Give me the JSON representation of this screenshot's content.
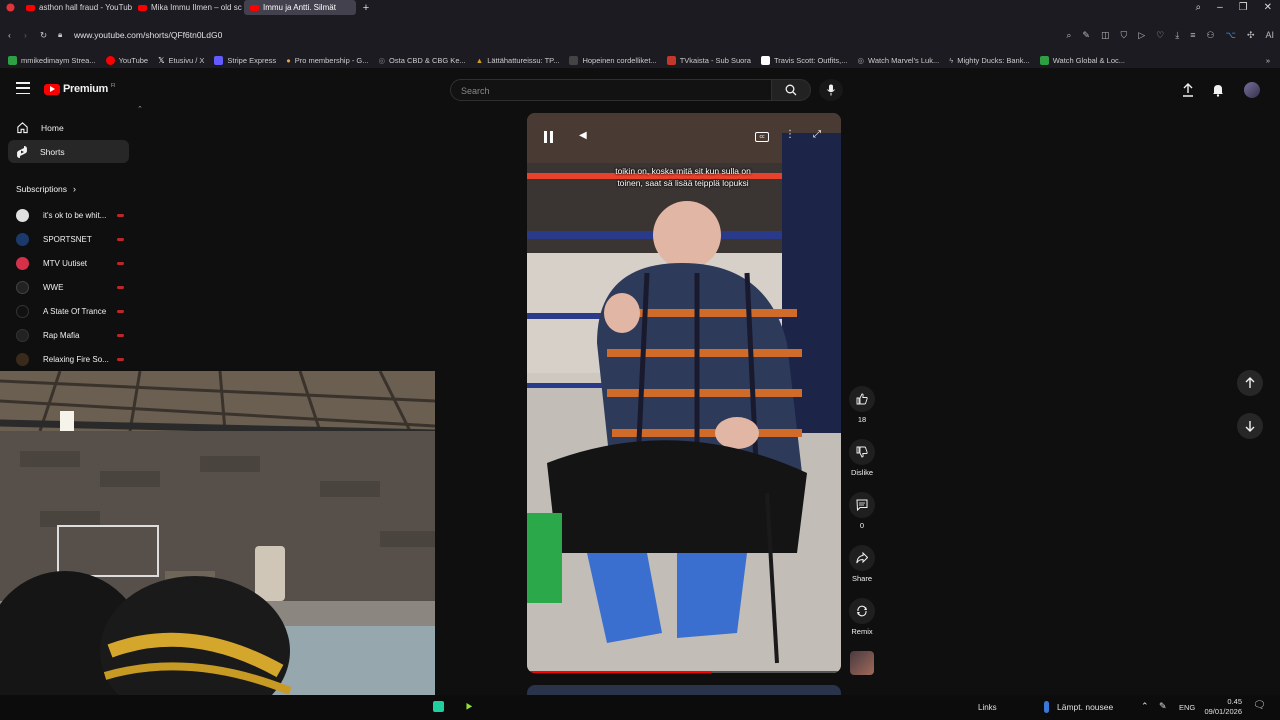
{
  "browser": {
    "tabs": [
      {
        "label": "asthon hall fraud - YouTub",
        "active": false
      },
      {
        "label": "Mika Immu Ilmen – old sc",
        "active": false
      },
      {
        "label": "Immu ja Antti. Silmät",
        "active": true
      }
    ],
    "url": "www.youtube.com/shorts/QFf6tn0LdG0",
    "bookmarks": [
      {
        "label": "mmikedimaym Strea...",
        "color": "#2ea043"
      },
      {
        "label": "YouTube",
        "color": "#ff0000"
      },
      {
        "label": "Etusivu / X",
        "color": "#ffffff"
      },
      {
        "label": "Stripe Express",
        "color": "#635bff"
      },
      {
        "label": "Pro membership - G...",
        "color": "#e8a33d"
      },
      {
        "label": "Osta CBD & CBG Ke...",
        "color": "#888888"
      },
      {
        "label": "Lättähattureissu: TP...",
        "color": "#d4a017"
      },
      {
        "label": "Hopeinen cordelliket...",
        "color": "#444444"
      },
      {
        "label": "TVkaista - Sub Suora",
        "color": "#c0392b"
      },
      {
        "label": "Travis Scott: Outfits,...",
        "color": "#ffffff"
      },
      {
        "label": "Watch Marvel's Luk...",
        "color": "#aaaaaa"
      },
      {
        "label": "Mighty Ducks: Bank...",
        "color": "#aaaaaa"
      },
      {
        "label": "Watch Global & Loc...",
        "color": "#2ea043"
      }
    ]
  },
  "youtube": {
    "logo_text": "Premium",
    "logo_badge": "FI",
    "search_placeholder": "Search",
    "sidebar": {
      "items": [
        {
          "label": "Home",
          "icon": "home-icon"
        },
        {
          "label": "Shorts",
          "icon": "shorts-icon"
        }
      ],
      "subscriptions_title": "Subscriptions",
      "subscriptions": [
        {
          "label": "it's ok to be whit...",
          "color": "#e0e0e0"
        },
        {
          "label": "SPORTSNET",
          "color": "#1a3a6b"
        },
        {
          "label": "MTV Uutiset",
          "color": "#d6304a"
        },
        {
          "label": "WWE",
          "color": "#222222"
        },
        {
          "label": "A State Of Trance",
          "color": "#111111"
        },
        {
          "label": "Rap Mafia",
          "color": "#222222"
        },
        {
          "label": "Relaxing Fire So...",
          "color": "#3a2a1a"
        }
      ]
    },
    "video": {
      "caption_line1": "toikin on, koska mitä sit kun sulla on",
      "caption_line2": "toinen, saat sä lisää teipplä lopuksi"
    },
    "actions": {
      "like_count": "18",
      "dislike_label": "Dislike",
      "comment_count": "0",
      "share_label": "Share",
      "remix_label": "Remix"
    }
  },
  "taskbar": {
    "links_label": "Links",
    "weather_text": "Lämpt. nousee",
    "language": "ENG",
    "time": "0.45",
    "date": "09/01/2026"
  }
}
